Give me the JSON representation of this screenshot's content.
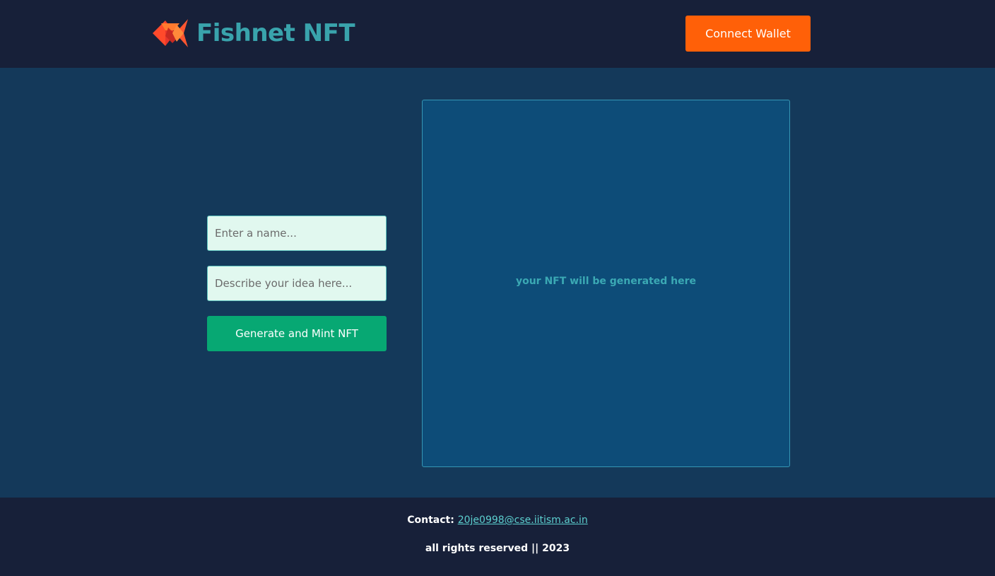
{
  "header": {
    "brand": "Fishnet NFT",
    "logo_icon": "fish-logo-icon",
    "connect_label": "Connect Wallet"
  },
  "form": {
    "name_placeholder": "Enter a name...",
    "name_value": "",
    "desc_placeholder": "Describe your idea here...",
    "desc_value": "",
    "submit_label": "Generate and Mint NFT"
  },
  "preview": {
    "placeholder_text": "your NFT will be generated here"
  },
  "footer": {
    "contact_label": "Contact:",
    "contact_email": "20je0998@cse.iitism.ac.in",
    "rights": "all rights reserved || 2023"
  },
  "colors": {
    "header_bg": "#172039",
    "main_bg": "#14395a",
    "brand": "#39a3ac",
    "connect_button": "#ff6008",
    "mint_button": "#07a873",
    "input_bg": "#e1f8ef",
    "preview_bg": "#0d4c78",
    "link": "#5ccfcf"
  }
}
